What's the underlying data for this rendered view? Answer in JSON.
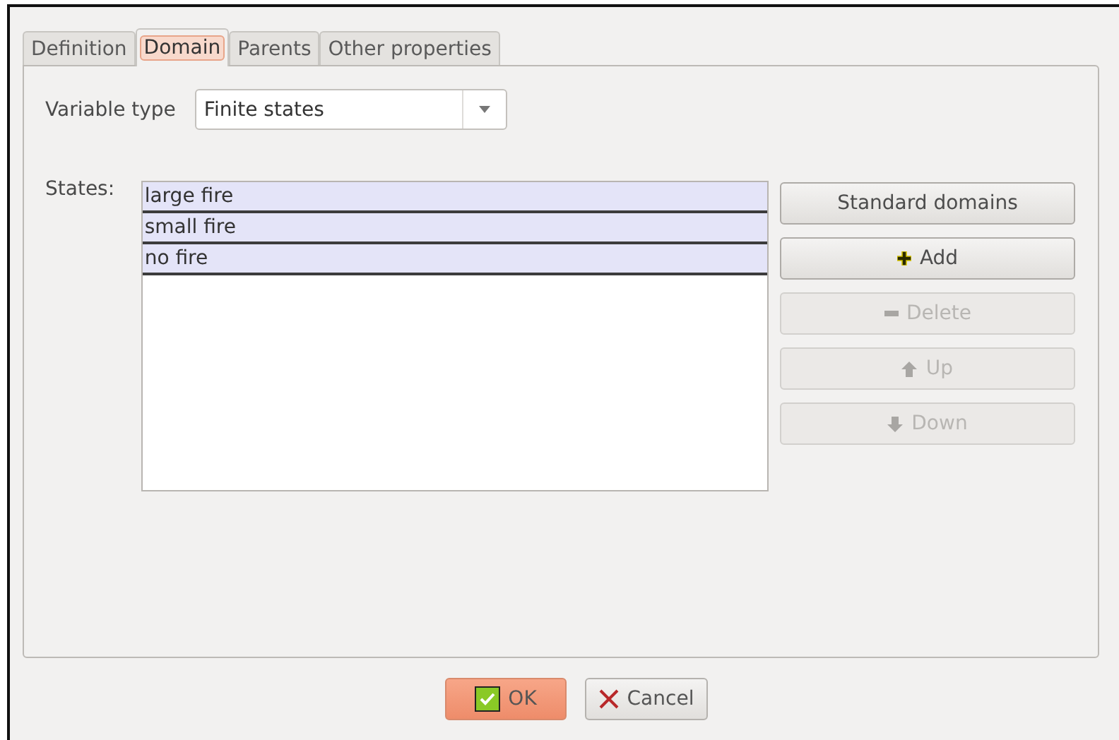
{
  "tabs": [
    {
      "label": "Definition",
      "selected": false
    },
    {
      "label": "Domain",
      "selected": true
    },
    {
      "label": "Parents",
      "selected": false
    },
    {
      "label": "Other properties",
      "selected": false
    }
  ],
  "variable_type": {
    "label": "Variable type",
    "value": "Finite states"
  },
  "states": {
    "label": "States:",
    "items": [
      {
        "label": "large fire",
        "selected": true
      },
      {
        "label": "small fire",
        "selected": true
      },
      {
        "label": "no fire",
        "selected": true
      }
    ]
  },
  "side_buttons": [
    {
      "label": "Standard domains",
      "kind": "plain",
      "disabled": false
    },
    {
      "label": "Add",
      "kind": "add",
      "disabled": false
    },
    {
      "label": "Delete",
      "kind": "delete",
      "disabled": true
    },
    {
      "label": "Up",
      "kind": "up",
      "disabled": true
    },
    {
      "label": "Down",
      "kind": "down",
      "disabled": true
    }
  ],
  "footer_buttons": [
    {
      "label": "OK",
      "kind": "ok",
      "default": true
    },
    {
      "label": "Cancel",
      "kind": "cancel",
      "default": false
    }
  ]
}
